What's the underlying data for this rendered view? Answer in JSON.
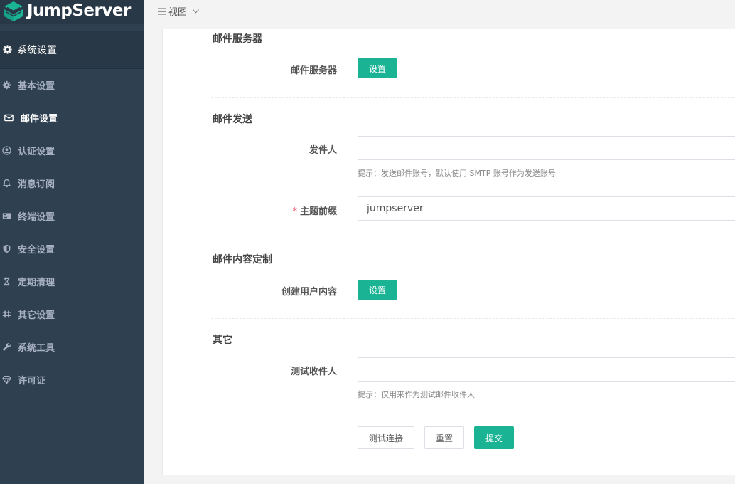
{
  "brand": {
    "name": "JumpServer",
    "color": "#1ab394"
  },
  "sidebar": {
    "header": {
      "label": "系统设置",
      "icon": "gear-icon"
    },
    "items": [
      {
        "label": "基本设置",
        "icon": "gear-icon",
        "active": false
      },
      {
        "label": "邮件设置",
        "icon": "envelope-icon",
        "active": true
      },
      {
        "label": "认证设置",
        "icon": "user-circle-icon",
        "active": false
      },
      {
        "label": "消息订阅",
        "icon": "bell-icon",
        "active": false
      },
      {
        "label": "终端设置",
        "icon": "terminal-icon",
        "active": false
      },
      {
        "label": "安全设置",
        "icon": "shield-icon",
        "active": false
      },
      {
        "label": "定期清理",
        "icon": "hourglass-icon",
        "active": false
      },
      {
        "label": "其它设置",
        "icon": "sliders-icon",
        "active": false
      },
      {
        "label": "系统工具",
        "icon": "wrench-icon",
        "active": false
      },
      {
        "label": "许可证",
        "icon": "diamond-icon",
        "active": false
      }
    ]
  },
  "topbar": {
    "view_label": "视图"
  },
  "form": {
    "sections": {
      "mail_server": "邮件服务器",
      "mail_send": "邮件发送",
      "mail_content": "邮件内容定制",
      "other": "其它"
    },
    "mail_server_label": "邮件服务器",
    "mail_server_button": "设置",
    "sender_label": "发件人",
    "sender_value": "",
    "sender_hint": "提示：发送邮件账号，默认使用 SMTP 账号作为发送账号",
    "subject_prefix_required": "*",
    "subject_prefix_label": "主题前缀",
    "subject_prefix_value": "jumpserver",
    "create_user_content_label": "创建用户内容",
    "create_user_content_button": "设置",
    "test_recipient_label": "测试收件人",
    "test_recipient_value": "",
    "test_recipient_hint": "提示：仅用来作为测试邮件收件人",
    "buttons": {
      "test": "测试连接",
      "reset": "重置",
      "submit": "提交"
    }
  }
}
